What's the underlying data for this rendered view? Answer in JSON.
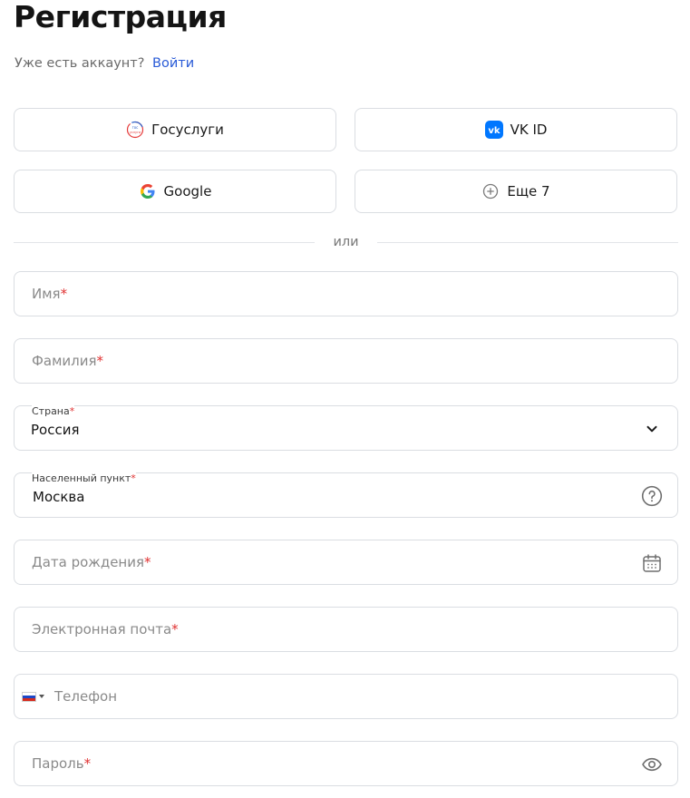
{
  "header": {
    "title": "Регистрация",
    "login_prompt": "Уже есть аккаунт?",
    "login_link": "Войти"
  },
  "social": {
    "gosuslugi": "Госуслуги",
    "vkid": "VK ID",
    "google": "Google",
    "more": "Еще 7"
  },
  "divider": "или",
  "form": {
    "first_name": {
      "placeholder": "Имя",
      "required_mark": "*"
    },
    "last_name": {
      "placeholder": "Фамилия",
      "required_mark": "*"
    },
    "country": {
      "label": "Страна",
      "required_mark": "*",
      "value": "Россия"
    },
    "city": {
      "label": "Населенный пункт",
      "required_mark": "*",
      "value": "Москва"
    },
    "birth_date": {
      "placeholder": "Дата рождения",
      "required_mark": "*"
    },
    "email": {
      "placeholder": "Электронная почта",
      "required_mark": "*"
    },
    "phone": {
      "placeholder": "Телефон"
    },
    "password": {
      "placeholder": "Пароль",
      "required_mark": "*"
    }
  },
  "colors": {
    "link": "#2a5bd7",
    "required": "#e03131",
    "vk": "#0077ff",
    "border": "#dadde2"
  },
  "icons": {
    "gosuslugi": "gosuslugi-logo-icon",
    "vkid": "vk-logo-icon",
    "google": "google-logo-icon",
    "more": "plus-circle-icon",
    "country": "chevron-down-icon",
    "city": "question-circle-icon",
    "birth_date": "calendar-icon",
    "phone": "russia-flag-icon",
    "password": "eye-icon"
  }
}
